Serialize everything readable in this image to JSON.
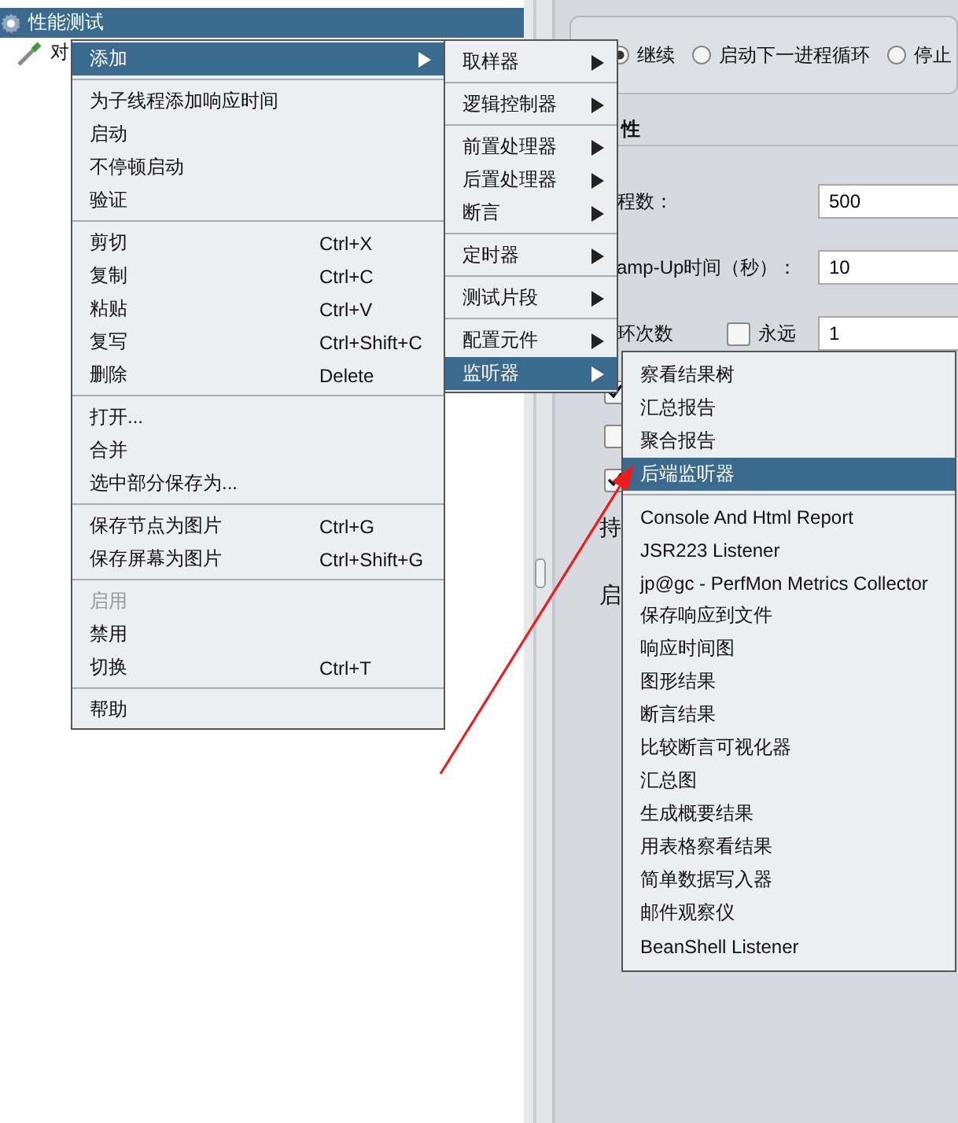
{
  "tree": {
    "items": [
      {
        "label": "性能测试",
        "selected": true
      },
      {
        "label": "对",
        "selected": false
      }
    ]
  },
  "thread_group": {
    "radios": [
      {
        "label": "继续",
        "selected": true
      },
      {
        "label": "启动下一进程循环",
        "selected": false
      },
      {
        "label": "停止",
        "selected": false
      }
    ],
    "section_title": "性",
    "fields": [
      {
        "label": "程数：",
        "value": "500"
      },
      {
        "label": "amp-Up时间（秒）：",
        "value": "10"
      },
      {
        "label": "环次数",
        "value": "1",
        "forever": {
          "label": "永远",
          "checked": false
        }
      }
    ],
    "checkboxes": [
      {
        "checked": true
      },
      {
        "checked": false
      },
      {
        "checked": true
      }
    ],
    "labels": [
      "持",
      "启"
    ]
  },
  "context_menu": {
    "groups": [
      [
        {
          "label": "添加",
          "submenu": true,
          "selected": true
        }
      ],
      [
        {
          "label": "为子线程添加响应时间"
        },
        {
          "label": "启动"
        },
        {
          "label": "不停顿启动"
        },
        {
          "label": "验证"
        }
      ],
      [
        {
          "label": "剪切",
          "shortcut": "Ctrl+X"
        },
        {
          "label": "复制",
          "shortcut": "Ctrl+C"
        },
        {
          "label": "粘贴",
          "shortcut": "Ctrl+V"
        },
        {
          "label": "复写",
          "shortcut": "Ctrl+Shift+C"
        },
        {
          "label": "删除",
          "shortcut": "Delete"
        }
      ],
      [
        {
          "label": "打开..."
        },
        {
          "label": "合并"
        },
        {
          "label": "选中部分保存为..."
        }
      ],
      [
        {
          "label": "保存节点为图片",
          "shortcut": "Ctrl+G"
        },
        {
          "label": "保存屏幕为图片",
          "shortcut": "Ctrl+Shift+G"
        }
      ],
      [
        {
          "label": "启用",
          "disabled": true
        },
        {
          "label": "禁用"
        },
        {
          "label": "切换",
          "shortcut": "Ctrl+T"
        }
      ],
      [
        {
          "label": "帮助"
        }
      ]
    ]
  },
  "add_submenu": {
    "groups": [
      [
        {
          "label": "取样器",
          "submenu": true
        }
      ],
      [
        {
          "label": "逻辑控制器",
          "submenu": true
        }
      ],
      [
        {
          "label": "前置处理器",
          "submenu": true
        },
        {
          "label": "后置处理器",
          "submenu": true
        },
        {
          "label": "断言",
          "submenu": true
        }
      ],
      [
        {
          "label": "定时器",
          "submenu": true
        }
      ],
      [
        {
          "label": "测试片段",
          "submenu": true
        }
      ],
      [
        {
          "label": "配置元件",
          "submenu": true
        },
        {
          "label": "监听器",
          "submenu": true,
          "selected": true
        }
      ]
    ]
  },
  "listener_submenu": {
    "groups": [
      [
        {
          "label": "察看结果树"
        },
        {
          "label": "汇总报告"
        },
        {
          "label": "聚合报告"
        },
        {
          "label": "后端监听器",
          "selected": true
        }
      ],
      [
        {
          "label": "Console And Html Report"
        },
        {
          "label": "JSR223 Listener"
        },
        {
          "label": "jp@gc - PerfMon Metrics Collector"
        },
        {
          "label": "保存响应到文件"
        },
        {
          "label": "响应时间图"
        },
        {
          "label": "图形结果"
        },
        {
          "label": "断言结果"
        },
        {
          "label": "比较断言可视化器"
        },
        {
          "label": "汇总图"
        },
        {
          "label": "生成概要结果"
        },
        {
          "label": "用表格察看结果"
        },
        {
          "label": "简单数据写入器"
        },
        {
          "label": "邮件观察仪"
        },
        {
          "label": "BeanShell Listener"
        }
      ]
    ]
  }
}
